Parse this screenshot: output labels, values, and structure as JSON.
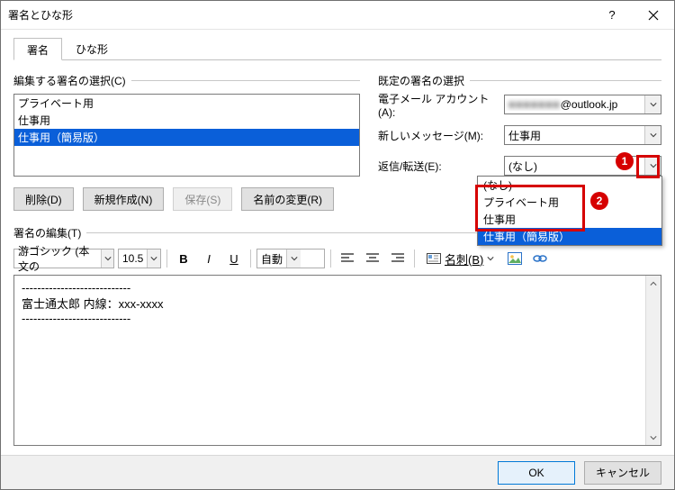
{
  "window": {
    "title": "署名とひな形"
  },
  "tabs": {
    "signature": "署名",
    "template": "ひな形"
  },
  "left": {
    "group_label": "編集する署名の選択(C)",
    "items": [
      "プライベート用",
      "仕事用",
      "仕事用（簡易版）"
    ],
    "buttons": {
      "delete": "削除(D)",
      "new": "新規作成(N)",
      "save": "保存(S)",
      "rename": "名前の変更(R)"
    },
    "edit_label": "署名の編集(T)"
  },
  "right": {
    "group_label": "既定の署名の選択",
    "account_label": "電子メール アカウント(A):",
    "account_value_suffix": "@outlook.jp",
    "account_value_blurred": "■■■■■■■",
    "newmsg_label": "新しいメッセージ(M):",
    "newmsg_value": "仕事用",
    "reply_label": "返信/転送(E):",
    "reply_value": "(なし)",
    "reply_options": [
      "(なし)",
      "プライベート用",
      "仕事用",
      "仕事用（簡易版）"
    ]
  },
  "callouts": {
    "one": "1",
    "two": "2"
  },
  "toolbar": {
    "font": "游ゴシック (本文の",
    "size": "10.5",
    "auto": "自動",
    "card_label": "名刺(B)"
  },
  "editor": {
    "line1": "----------------------------",
    "line2": "富士通太郎  内線：xxx-xxxx",
    "line3": "----------------------------"
  },
  "footer": {
    "ok": "OK",
    "cancel": "キャンセル"
  }
}
